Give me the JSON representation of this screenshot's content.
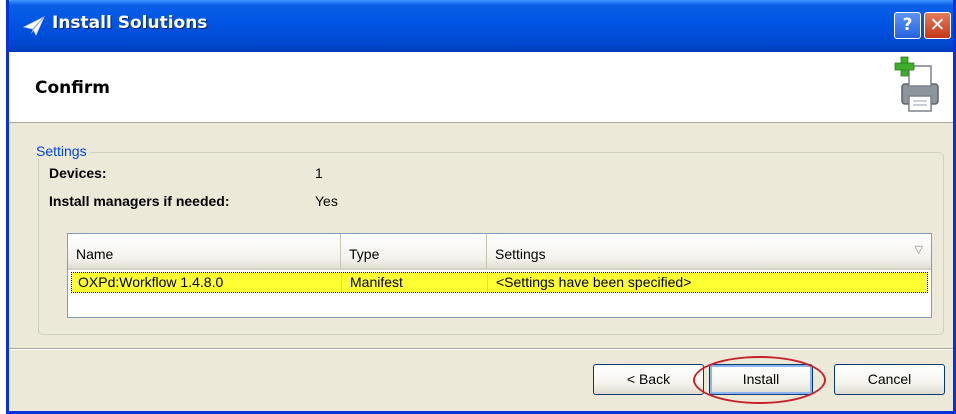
{
  "window": {
    "title": "Install Solutions",
    "help_label": "?",
    "close_label": "✕"
  },
  "header": {
    "title": "Confirm"
  },
  "settings": {
    "legend": "Settings",
    "devices_label": "Devices:",
    "devices_value": "1",
    "managers_label": "Install managers if needed:",
    "managers_value": "Yes"
  },
  "grid": {
    "columns": [
      "Name",
      "Type",
      "Settings"
    ],
    "rows": [
      {
        "name": "OXPd:Workflow 1.4.8.0",
        "type": "Manifest",
        "settings": "<Settings have been specified>"
      }
    ],
    "highlight_color": "#ffff33"
  },
  "buttons": {
    "back": "< Back",
    "install": "Install",
    "cancel": "Cancel"
  },
  "annotation": {
    "ring_color": "#c8232c"
  },
  "icons": {
    "title": "paper-plane-icon",
    "header": "printer-add-icon",
    "sort": "sort-arrow-icon"
  }
}
